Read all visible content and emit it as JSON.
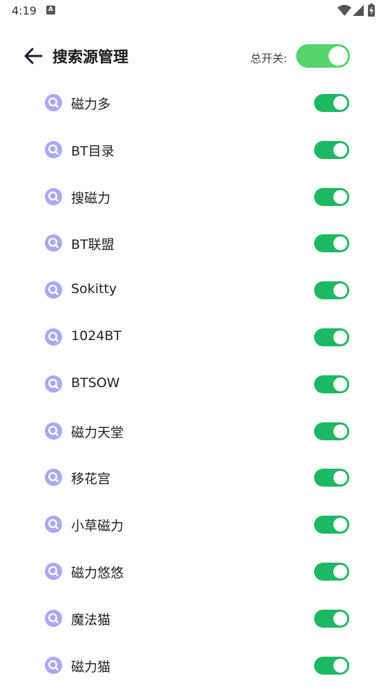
{
  "status": {
    "time": "4:19",
    "notif_glyph": "A",
    "icons": [
      "wifi-icon",
      "signal-icon",
      "battery-charging-icon"
    ]
  },
  "header": {
    "title": "搜索源管理",
    "master_label": "总开关:",
    "master_on": true,
    "back_icon": "arrow-left-icon"
  },
  "colors": {
    "toggle_on": "#1db863",
    "master_toggle_on": "#57d36a",
    "icon_accent": "#8f8ff0"
  },
  "sources": [
    {
      "label": "磁力多",
      "enabled": true
    },
    {
      "label": "BT目录",
      "enabled": true
    },
    {
      "label": "搜磁力",
      "enabled": true
    },
    {
      "label": "BT联盟",
      "enabled": true
    },
    {
      "label": "Sokitty",
      "enabled": true
    },
    {
      "label": "1024BT",
      "enabled": true
    },
    {
      "label": "BTSOW",
      "enabled": true
    },
    {
      "label": "磁力天堂",
      "enabled": true
    },
    {
      "label": "移花宫",
      "enabled": true
    },
    {
      "label": "小草磁力",
      "enabled": true
    },
    {
      "label": "磁力悠悠",
      "enabled": true
    },
    {
      "label": "魔法猫",
      "enabled": true
    },
    {
      "label": "磁力猫",
      "enabled": true
    }
  ]
}
